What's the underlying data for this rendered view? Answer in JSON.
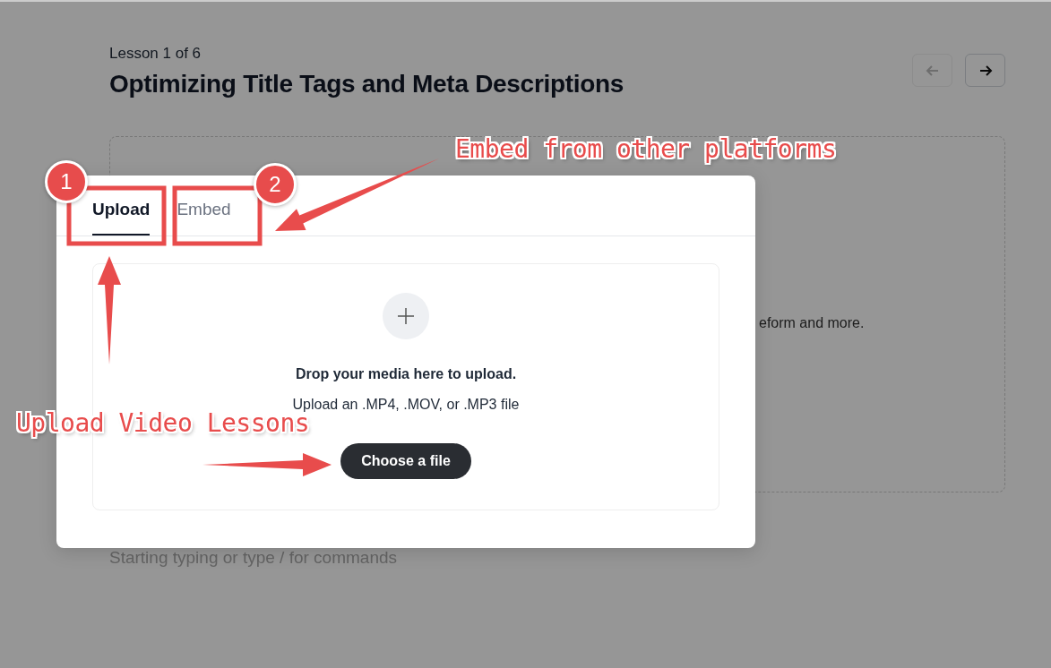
{
  "lesson": {
    "counter": "Lesson 1 of 6",
    "title": "Optimizing Title Tags and Meta Descriptions"
  },
  "nav": [
    {
      "kind": "prev",
      "disabled": true
    },
    {
      "kind": "next",
      "disabled": false
    }
  ],
  "media_placeholder": {
    "text": "eform and more."
  },
  "editor": {
    "placeholder": "Starting typing or type / for commands"
  },
  "modal": {
    "tabs": [
      {
        "label": "Upload",
        "selected": true
      },
      {
        "label": "Embed",
        "selected": false
      }
    ],
    "dropzone": {
      "title": "Drop your media here to upload.",
      "subtitle": "Upload an .MP4, .MOV, or .MP3 file",
      "button": "Choose a file"
    }
  },
  "annotations": {
    "markers": [
      "1",
      "2"
    ],
    "labels": [
      "Embed from other platforms",
      "Upload Video Lessons"
    ]
  }
}
